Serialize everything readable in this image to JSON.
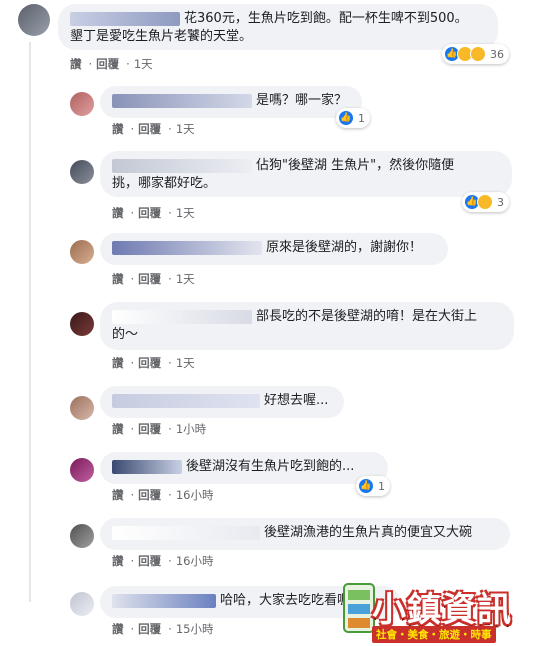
{
  "comments": [
    {
      "text_line1": "花360元，生魚片吃到飽。配一杯生啤不到500。",
      "text_line2": "墾丁是愛吃生魚片老饕的天堂。",
      "like": "讚",
      "reply": "回覆",
      "time": "1天",
      "reaction_count": "36"
    },
    {
      "text": "是嗎？哪一家？",
      "like": "讚",
      "reply": "回覆",
      "time": "1天",
      "reaction_count": "1"
    },
    {
      "text_line1": "佔狗\"後壁湖 生魚片\"，然後你隨便",
      "text_line2": "挑，哪家都好吃。",
      "like": "讚",
      "reply": "回覆",
      "time": "1天",
      "reaction_count": "3"
    },
    {
      "text": "原來是後壁湖的，謝謝你！",
      "like": "讚",
      "reply": "回覆",
      "time": "1天"
    },
    {
      "text_line1": "部長吃的不是後壁湖的唷！是在大街上",
      "text_line2": "的～",
      "like": "讚",
      "reply": "回覆",
      "time": "1天"
    },
    {
      "text": "好想去喔...",
      "like": "讚",
      "reply": "回覆",
      "time": "1小時"
    },
    {
      "text": "後壁湖沒有生魚片吃到飽的...",
      "like": "讚",
      "reply": "回覆",
      "time": "16小時",
      "reaction_count": "1"
    },
    {
      "text": "後壁湖漁港的生魚片真的便宜又大碗",
      "like": "讚",
      "reply": "回覆",
      "time": "16小時"
    },
    {
      "text": "哈哈，大家去吃吃看喔",
      "like": "讚",
      "reply": "回覆",
      "time": "15小時"
    }
  ],
  "watermark": {
    "title": "小鎮資訊",
    "subtitle": "社會・美食・旅遊・時事"
  },
  "icons": [
    "like-icon",
    "wow-icon",
    "haha-icon"
  ],
  "colors": {
    "bubble": "#f0f2f5",
    "like_blue": "#1877f2",
    "meta_gray": "#65676b",
    "watermark_red": "#c9302c"
  }
}
